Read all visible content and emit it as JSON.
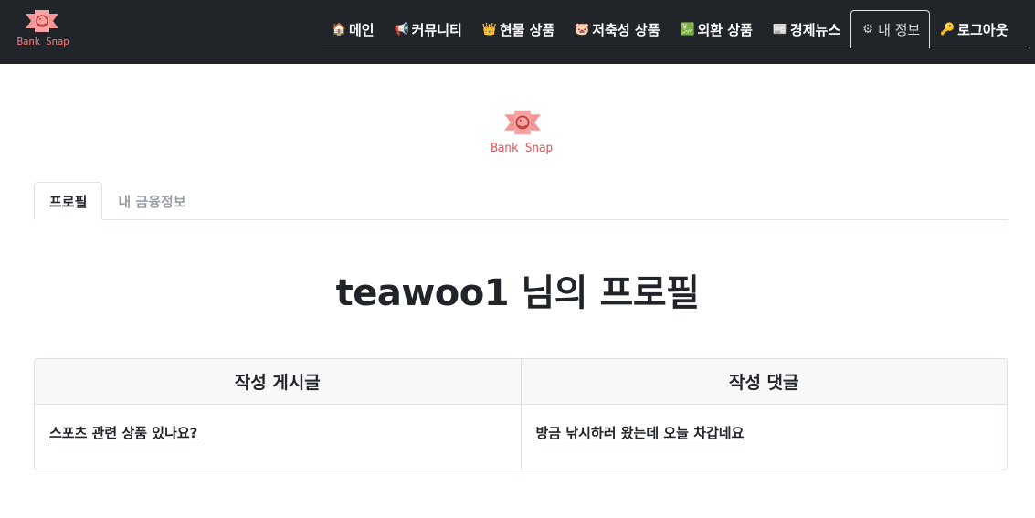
{
  "brand": {
    "name": "Bank Snap"
  },
  "nav": {
    "items": [
      {
        "icon": "house-icon",
        "glyph": "🏠",
        "label": "메인"
      },
      {
        "icon": "megaphone-icon",
        "glyph": "📢",
        "label": "커뮤니티"
      },
      {
        "icon": "crown-icon",
        "glyph": "👑",
        "label": "현물 상품"
      },
      {
        "icon": "pig-icon",
        "glyph": "🐷",
        "label": "저축성 상품"
      },
      {
        "icon": "exchange-icon",
        "glyph": "💹",
        "label": "외환 상품"
      },
      {
        "icon": "newspaper-icon",
        "glyph": "📰",
        "label": "경제뉴스"
      },
      {
        "icon": "gear-icon",
        "glyph": "⚙",
        "label": "내 정보"
      },
      {
        "icon": "key-icon",
        "glyph": "🔑",
        "label": "로그아웃"
      }
    ],
    "active_index": 6
  },
  "tabs": {
    "profile": "프로필",
    "finance": "내 금융정보"
  },
  "profile": {
    "title": "teawoo1 님의 프로필"
  },
  "activity": {
    "posts_header": "작성 게시글",
    "comments_header": "작성 댓글",
    "posts": [
      "스포츠 관련 상품 있나요?"
    ],
    "comments": [
      "방금 낚시하러 왔는데 오늘 차갑네요"
    ]
  },
  "colors": {
    "navbar_bg": "#212529",
    "brand_red": "#f07a7a",
    "border": "#dee2e6"
  }
}
